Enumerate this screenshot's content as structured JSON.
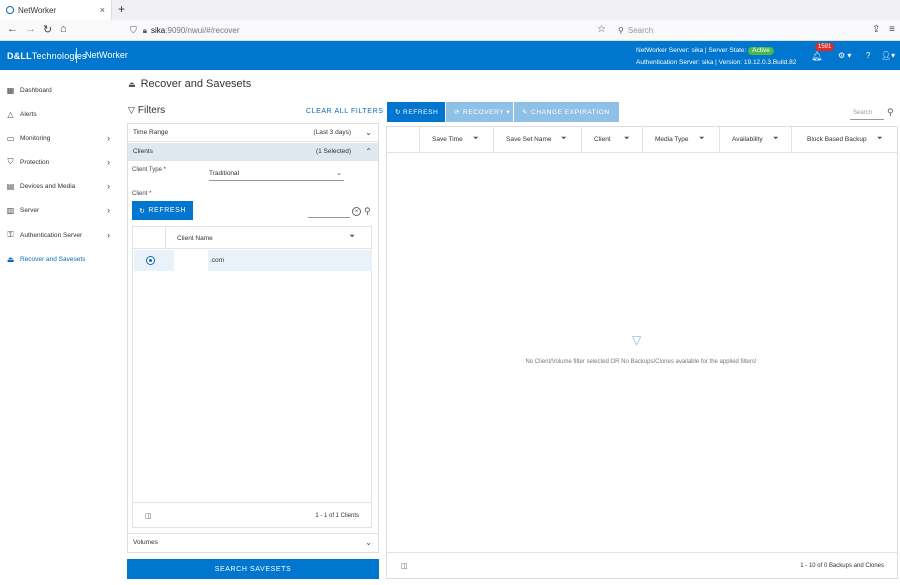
{
  "browser": {
    "tab_title": "NetWorker",
    "tab_close": "×",
    "new_tab": "+",
    "url_host": "sika",
    "url_path": ":9090/nwui/#/recover",
    "search_placeholder": "Search"
  },
  "header": {
    "brand_dell": "D&LL",
    "brand_tech": "Technologies",
    "product": "NetWorker",
    "server_line_prefix": "NetWorker Server: sika | Server State:",
    "server_state": "Active",
    "auth_line": "Authentication Server: sika | Version: 19.12.0.3.Build.82",
    "notification_count": "1591"
  },
  "sidebar": {
    "items": [
      {
        "label": "Dashboard",
        "icon": "dashboard-icon"
      },
      {
        "label": "Alerts",
        "icon": "bell-icon"
      },
      {
        "label": "Monitoring",
        "icon": "monitor-icon"
      },
      {
        "label": "Protection",
        "icon": "shield-icon"
      },
      {
        "label": "Devices and Media",
        "icon": "devices-icon"
      },
      {
        "label": "Server",
        "icon": "server-icon"
      },
      {
        "label": "Authentication Server",
        "icon": "key-icon"
      },
      {
        "label": "Recover and Savesets",
        "icon": "recover-icon"
      }
    ]
  },
  "page": {
    "title": "Recover and Savesets"
  },
  "filters": {
    "heading": "Filters",
    "clear_all": "CLEAR ALL FILTERS",
    "time_range_label": "Time Range",
    "time_range_value": "(Last 3 days)",
    "clients_label": "Clients",
    "clients_value": "(1 Selected)",
    "client_type_label": "Client Type",
    "client_type_value": "Traditional",
    "client_label": "Client",
    "refresh_label": "REFRESH",
    "client_name_header": "Client Name",
    "client_row_name": ".com",
    "clients_count": "1 - 1 of 1 Clients",
    "volumes_label": "Volumes",
    "search_savesets": "SEARCH SAVESETS"
  },
  "results": {
    "toolbar": {
      "refresh": "REFRESH",
      "recovery": "RECOVERY",
      "change_expiration": "CHANGE EXPIRATION"
    },
    "search_placeholder": "Search",
    "columns": [
      "Save Time",
      "Save Set Name",
      "Client",
      "Media Type",
      "Availability",
      "Block Based Backup"
    ],
    "empty_message": "No Client/Volume filter selected OR No Backups/Clones available for the applied filters!",
    "count": "1 - 10 of 0 Backups and Clones"
  },
  "colors": {
    "brand_blue": "#0076ce",
    "disabled_blue": "#8fc1e6",
    "active_green": "#4bb84b",
    "badge_red": "#e02b27"
  }
}
